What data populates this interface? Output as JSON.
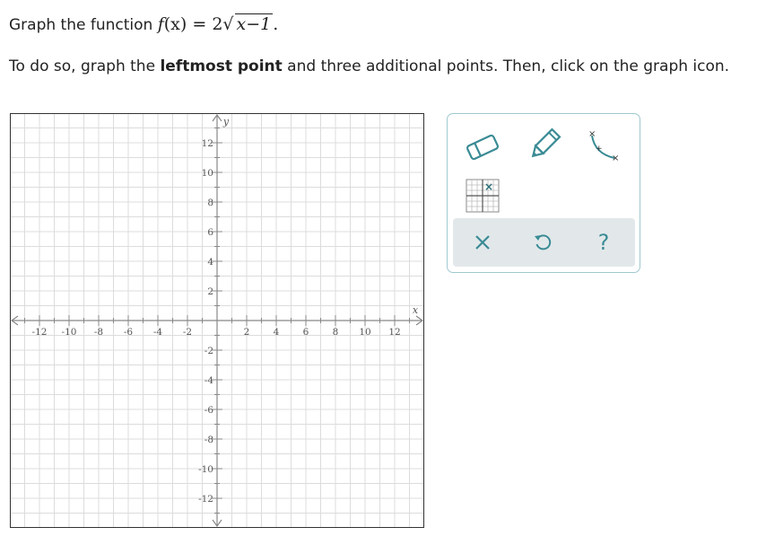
{
  "question": {
    "prefix": "Graph the function",
    "func_name": "f",
    "func_arg": "(x)",
    "equals": "=",
    "coefficient": "2",
    "radicand": "x−1",
    "period": ".",
    "instruction_before": "To do so, graph the ",
    "instruction_bold": "leftmost point",
    "instruction_after": " and three additional points. Then, click on the graph icon."
  },
  "graph": {
    "x_axis_label": "x",
    "y_axis_label": "y",
    "x_range": [
      -14,
      14
    ],
    "y_range": [
      -14,
      14
    ],
    "grid_step": 1,
    "label_step": 2,
    "x_tick_labels": [
      "-12",
      "-10",
      "-8",
      "-6",
      "-4",
      "-2",
      "2",
      "4",
      "6",
      "8",
      "10",
      "12"
    ],
    "y_tick_labels": [
      "12",
      "10",
      "8",
      "6",
      "4",
      "2",
      "-2",
      "-4",
      "-6",
      "-8",
      "-10",
      "-12"
    ]
  },
  "toolbar": {
    "tools": [
      "eraser-icon",
      "pencil-icon",
      "curve-graph-icon",
      "point-grid-icon"
    ],
    "actions": [
      "clear-icon",
      "undo-icon",
      "help-icon"
    ],
    "help_label": "?",
    "accent_color": "#3a8b95",
    "border_color": "#9fc9cf",
    "action_bar_color": "#e2e8ea"
  }
}
